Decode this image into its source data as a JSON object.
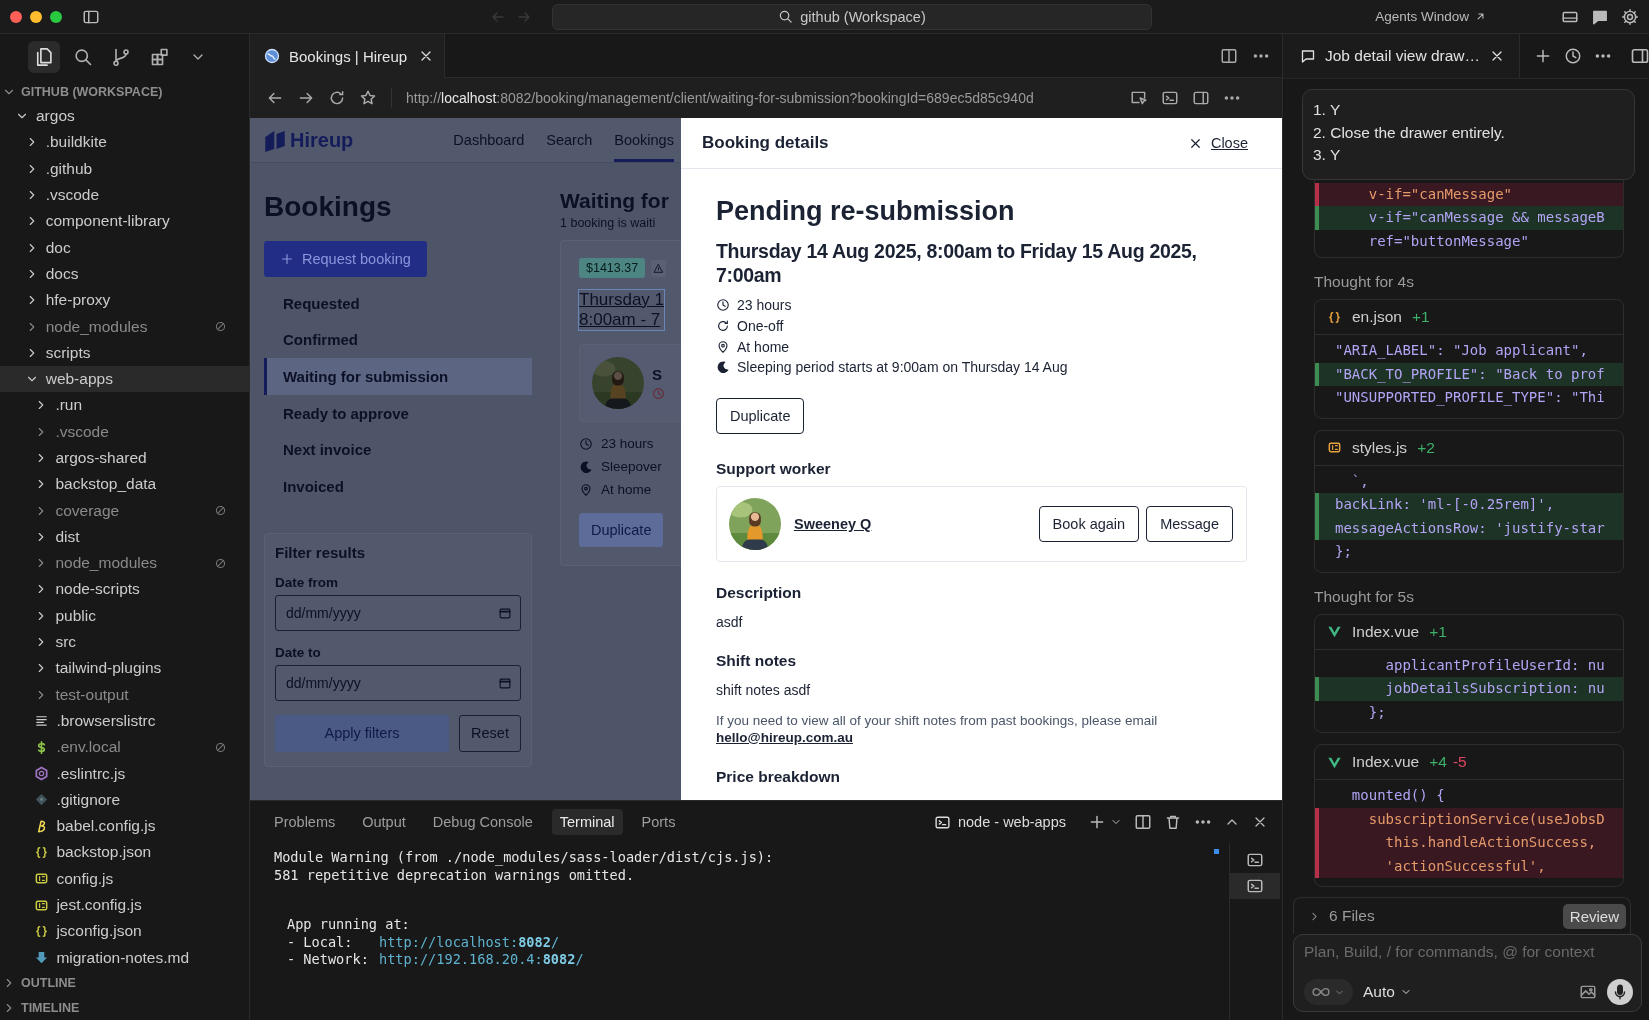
{
  "titlebar": {
    "search": "github (Workspace)",
    "agents_window": "Agents Window"
  },
  "explorer": {
    "workspace": "GITHUB (WORKSPACE)",
    "expanded": true,
    "tree": [
      {
        "name": "argos",
        "kind": "folder",
        "expanded": true,
        "selected": false,
        "dimmed": false,
        "excluded": false,
        "children": [
          {
            "name": ".buildkite",
            "kind": "folder",
            "expanded": false,
            "selected": false,
            "dimmed": false,
            "excluded": false
          },
          {
            "name": ".github",
            "kind": "folder",
            "expanded": false,
            "selected": false,
            "dimmed": false,
            "excluded": false
          },
          {
            "name": ".vscode",
            "kind": "folder",
            "expanded": false,
            "selected": false,
            "dimmed": false,
            "excluded": false
          },
          {
            "name": "component-library",
            "kind": "folder",
            "expanded": false,
            "selected": false,
            "dimmed": false,
            "excluded": false
          },
          {
            "name": "doc",
            "kind": "folder",
            "expanded": false,
            "selected": false,
            "dimmed": false,
            "excluded": false
          },
          {
            "name": "docs",
            "kind": "folder",
            "expanded": false,
            "selected": false,
            "dimmed": false,
            "excluded": false
          },
          {
            "name": "hfe-proxy",
            "kind": "folder",
            "expanded": false,
            "selected": false,
            "dimmed": false,
            "excluded": false
          },
          {
            "name": "node_modules",
            "kind": "folder",
            "expanded": false,
            "selected": false,
            "dimmed": true,
            "excluded": true
          },
          {
            "name": "scripts",
            "kind": "folder",
            "expanded": false,
            "selected": false,
            "dimmed": false,
            "excluded": false
          },
          {
            "name": "web-apps",
            "kind": "folder",
            "expanded": true,
            "selected": true,
            "dimmed": false,
            "excluded": false,
            "children": [
              {
                "name": ".run",
                "kind": "folder",
                "expanded": false,
                "selected": false,
                "dimmed": false,
                "excluded": false
              },
              {
                "name": ".vscode",
                "kind": "folder",
                "expanded": false,
                "selected": false,
                "dimmed": true,
                "excluded": false
              },
              {
                "name": "argos-shared",
                "kind": "folder",
                "expanded": false,
                "selected": false,
                "dimmed": false,
                "excluded": false
              },
              {
                "name": "backstop_data",
                "kind": "folder",
                "expanded": false,
                "selected": false,
                "dimmed": false,
                "excluded": false
              },
              {
                "name": "coverage",
                "kind": "folder",
                "expanded": false,
                "selected": false,
                "dimmed": true,
                "excluded": true
              },
              {
                "name": "dist",
                "kind": "folder",
                "expanded": false,
                "selected": false,
                "dimmed": false,
                "excluded": false
              },
              {
                "name": "node_modules",
                "kind": "folder",
                "expanded": false,
                "selected": false,
                "dimmed": true,
                "excluded": true
              },
              {
                "name": "node-scripts",
                "kind": "folder",
                "expanded": false,
                "selected": false,
                "dimmed": false,
                "excluded": false
              },
              {
                "name": "public",
                "kind": "folder",
                "expanded": false,
                "selected": false,
                "dimmed": false,
                "excluded": false
              },
              {
                "name": "src",
                "kind": "folder",
                "expanded": false,
                "selected": false,
                "dimmed": false,
                "excluded": false
              },
              {
                "name": "tailwind-plugins",
                "kind": "folder",
                "expanded": false,
                "selected": false,
                "dimmed": false,
                "excluded": false
              },
              {
                "name": "test-output",
                "kind": "folder",
                "expanded": false,
                "selected": false,
                "dimmed": true,
                "excluded": false
              },
              {
                "name": ".browserslistrc",
                "kind": "text",
                "selected": false,
                "dimmed": false,
                "excluded": false
              },
              {
                "name": ".env.local",
                "kind": "env",
                "selected": false,
                "dimmed": true,
                "excluded": true
              },
              {
                "name": ".eslintrc.js",
                "kind": "eslint",
                "selected": false,
                "dimmed": false,
                "excluded": false
              },
              {
                "name": ".gitignore",
                "kind": "git",
                "selected": false,
                "dimmed": false,
                "excluded": false
              },
              {
                "name": "babel.config.js",
                "kind": "babel",
                "selected": false,
                "dimmed": false,
                "excluded": false
              },
              {
                "name": "backstop.json",
                "kind": "json",
                "selected": false,
                "dimmed": false,
                "excluded": false
              },
              {
                "name": "config.js",
                "kind": "js",
                "selected": false,
                "dimmed": false,
                "excluded": false
              },
              {
                "name": "jest.config.js",
                "kind": "js",
                "selected": false,
                "dimmed": false,
                "excluded": false
              },
              {
                "name": "jsconfig.json",
                "kind": "json",
                "selected": false,
                "dimmed": false,
                "excluded": false
              },
              {
                "name": "migration-notes.md",
                "kind": "markdown",
                "selected": false,
                "dimmed": false,
                "excluded": false
              }
            ]
          }
        ]
      }
    ],
    "sections": [
      {
        "title": "OUTLINE",
        "expanded": false
      },
      {
        "title": "TIMELINE",
        "expanded": false
      }
    ]
  },
  "browser": {
    "tab": "Bookings | Hireup",
    "url": "http://**localhost**:8082/booking/management/client/waiting-for-submission?bookingId=689ec5d85c940d",
    "page": {
      "logo": "Hireup",
      "nav": [
        {
          "label": "Dashboard",
          "selected": false
        },
        {
          "label": "Search",
          "selected": false
        },
        {
          "label": "Bookings",
          "selected": true
        }
      ],
      "title": "Bookings",
      "request_button": "Request booking",
      "statuses": [
        {
          "label": "Requested",
          "selected": false
        },
        {
          "label": "Confirmed",
          "selected": false
        },
        {
          "label": "Waiting for submission",
          "selected": true
        },
        {
          "label": "Ready to approve",
          "selected": false
        },
        {
          "label": "Next invoice",
          "selected": false
        },
        {
          "label": "Invoiced",
          "selected": false
        }
      ],
      "filter": {
        "title": "Filter results",
        "fields": [
          {
            "label": "Date from",
            "placeholder": "dd/mm/yyyy"
          },
          {
            "label": "Date to",
            "placeholder": "dd/mm/yyyy"
          }
        ],
        "apply": "Apply filters",
        "reset": "Reset"
      },
      "list": {
        "title": "Waiting for",
        "subtitle": "1 booking is waiti",
        "card": {
          "price": "$1413.37",
          "date_lines": [
            "Thursday 1",
            "8:00am - 7"
          ],
          "worker": "S",
          "details": [
            {
              "kind": "clock",
              "text": "23 hours"
            },
            {
              "kind": "moon",
              "text": "Sleepover"
            },
            {
              "kind": "pin",
              "text": "At home"
            }
          ],
          "button": "Duplicate"
        }
      }
    },
    "drawer": {
      "title": "Booking details",
      "close": "Close",
      "status": "Pending re-submission",
      "date": "Thursday 14 Aug 2025, 8:00am to Friday 15 Aug 2025, 7:00am",
      "details": [
        {
          "kind": "clock",
          "text": "23 hours"
        },
        {
          "kind": "repeat",
          "text": "One-off"
        },
        {
          "kind": "pin",
          "text": "At home"
        },
        {
          "kind": "moon",
          "text": "Sleeping period starts at 9:00am on Thursday 14 Aug"
        }
      ],
      "duplicate": "Duplicate",
      "worker_heading": "Support worker",
      "worker": {
        "name": "Sweeney Q",
        "actions": [
          "Book again",
          "Message"
        ]
      },
      "sections": [
        {
          "heading": "Description",
          "text": "asdf"
        },
        {
          "heading": "Shift notes",
          "text": "shift notes asdf",
          "note": "If you need to view all of your shift notes from past bookings, please email",
          "link": "hello@hireup.com.au"
        },
        {
          "heading": "Price breakdown"
        }
      ]
    }
  },
  "terminal": {
    "tabs": [
      {
        "label": "Problems",
        "selected": false
      },
      {
        "label": "Output",
        "selected": false
      },
      {
        "label": "Debug Console",
        "selected": false
      },
      {
        "label": "Terminal",
        "selected": true
      },
      {
        "label": "Ports",
        "selected": false
      }
    ],
    "session": "node - web-apps",
    "blocks": [
      {
        "indented": false,
        "lines": [
          {
            "text": "Module Warning (from ./node_modules/sass-loader/dist/cjs.js):"
          },
          {
            "text": "581 repetitive deprecation warnings omitted."
          }
        ]
      },
      {
        "indented": true,
        "lines": [
          {
            "text": "App running at:"
          },
          {
            "text": "- Local:",
            "link": "http://localhost:**8082**/"
          },
          {
            "text": "- Network:",
            "link": "http://192.168.20.4:**8082**/"
          }
        ]
      }
    ]
  },
  "agent": {
    "tab": "Job detail view draw…",
    "prompt": [
      "1. Y",
      "2. Close the drawer entirely.",
      "3. Y"
    ],
    "feed": [
      {
        "kind": "diff",
        "lines": [
          {
            "kind": "del",
            "text": "    v-if=\"canMessage\""
          },
          {
            "kind": "add",
            "text": "    v-if=\"canMessage && messageB"
          },
          {
            "kind": "ctx",
            "text": "    ref=\"buttonMessage\""
          }
        ]
      },
      {
        "kind": "thought",
        "text": "Thought for 4s"
      },
      {
        "kind": "diff",
        "file": {
          "name": "en.json",
          "kind": "json"
        },
        "added": "+1",
        "lines": [
          {
            "kind": "ctx",
            "text": "\"ARIA_LABEL\": \"Job applicant\","
          },
          {
            "kind": "add",
            "text": "\"BACK_TO_PROFILE\": \"Back to prof"
          },
          {
            "kind": "ctx",
            "text": "\"UNSUPPORTED_PROFILE_TYPE\": \"Thi"
          }
        ]
      },
      {
        "kind": "diff",
        "file": {
          "name": "styles.js",
          "kind": "js"
        },
        "added": "+2",
        "lines": [
          {
            "kind": "ctx",
            "text": "  `,"
          },
          {
            "kind": "add",
            "text": "backLink: 'ml-[-0.25rem]',"
          },
          {
            "kind": "add",
            "text": "messageActionsRow: 'justify-star"
          },
          {
            "kind": "ctx",
            "text": "};"
          }
        ]
      },
      {
        "kind": "thought",
        "text": "Thought for 5s"
      },
      {
        "kind": "diff",
        "file": {
          "name": "Index.vue",
          "kind": "vue"
        },
        "added": "+1",
        "lines": [
          {
            "kind": "ctx",
            "text": "      applicantProfileUserId: nu"
          },
          {
            "kind": "add",
            "text": "      jobDetailsSubscription: nu"
          },
          {
            "kind": "ctx",
            "text": "    };"
          }
        ]
      },
      {
        "kind": "diff",
        "file": {
          "name": "Index.vue",
          "kind": "vue"
        },
        "added": "+4",
        "removed": "-5",
        "lines": [
          {
            "kind": "ctx",
            "text": "  mounted() {"
          },
          {
            "kind": "del",
            "text": "    subscriptionService(useJobsD"
          },
          {
            "kind": "del",
            "text": "      this.handleActionSuccess,"
          },
          {
            "kind": "del",
            "text": "      'actionSuccessful',"
          }
        ]
      }
    ],
    "files": "6 Files",
    "review": "Review",
    "input": {
      "placeholder": "Plan, Build, / for commands, @ for context"
    },
    "mode": "Auto"
  }
}
